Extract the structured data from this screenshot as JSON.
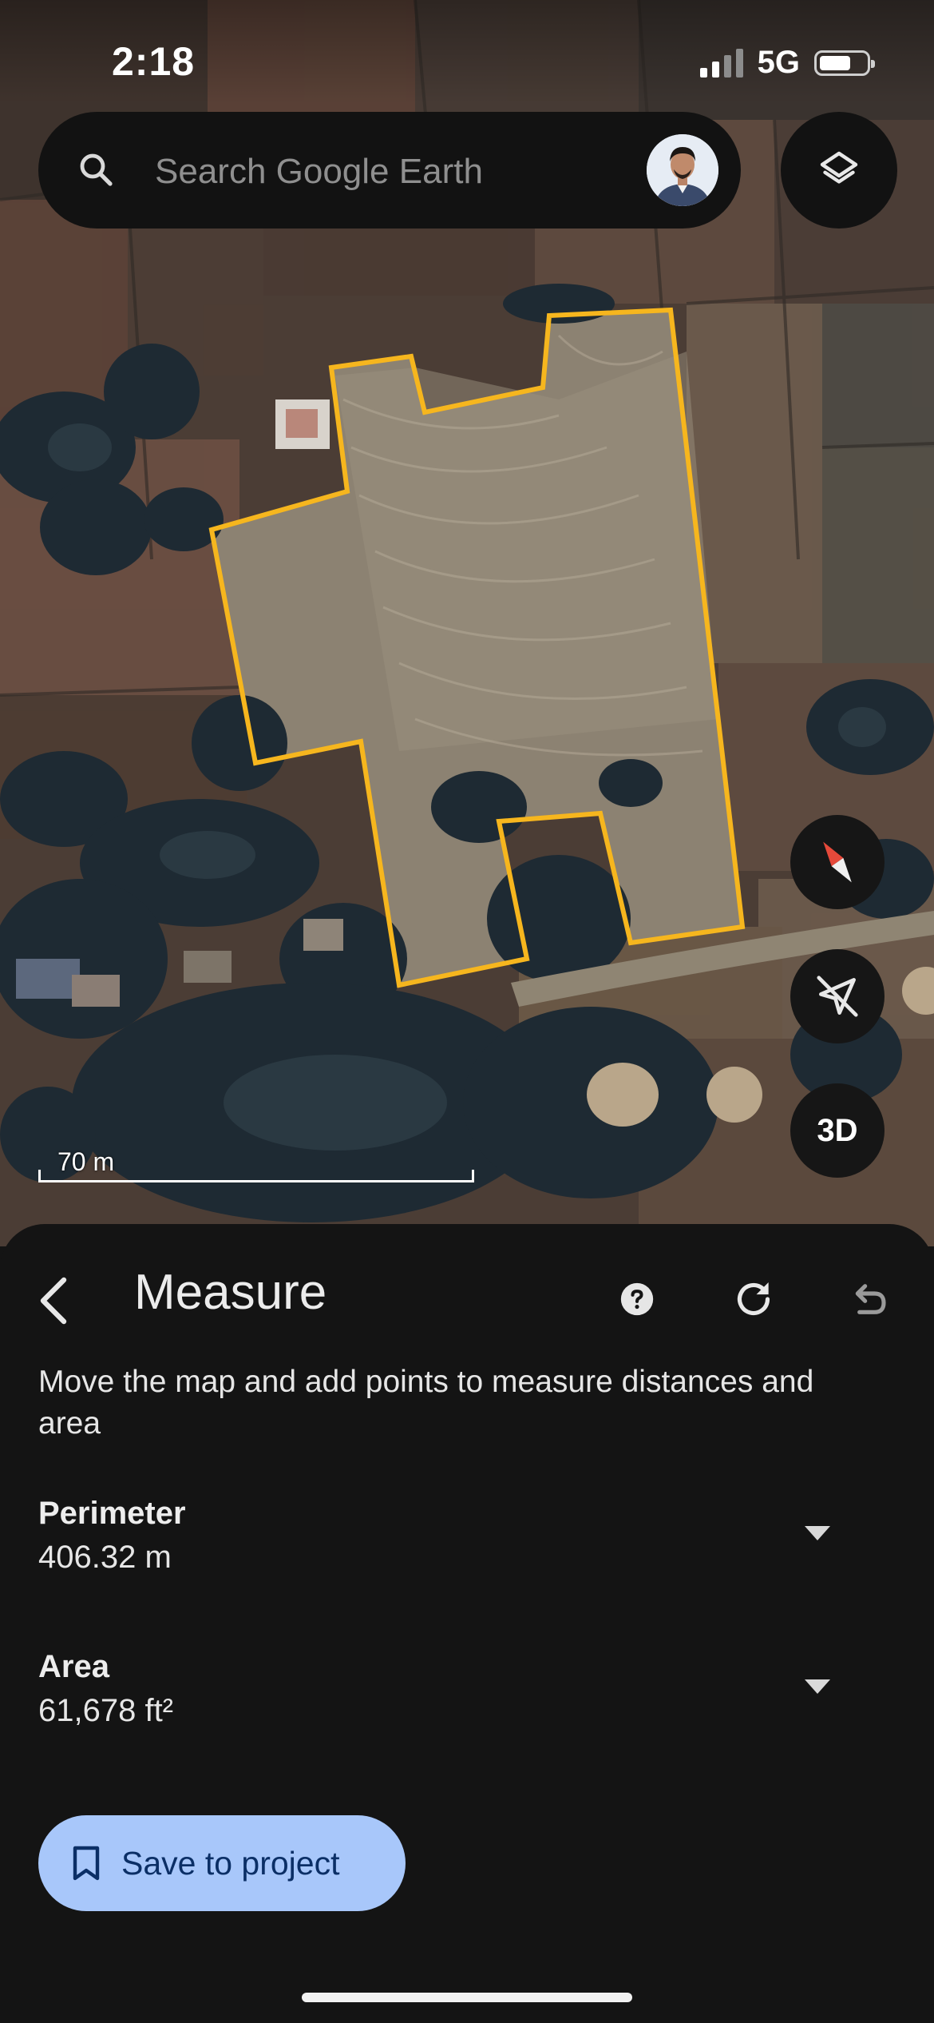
{
  "status_bar": {
    "time": "2:18",
    "network": "5G"
  },
  "search": {
    "placeholder": "Search Google Earth"
  },
  "map": {
    "scale_label": "70 m",
    "three_d_label": "3D"
  },
  "panel": {
    "title": "Measure",
    "description": "Move the map and add points to measure distances and area",
    "metrics": [
      {
        "label": "Perimeter",
        "value": "406.32 m"
      },
      {
        "label": "Area",
        "value": "61,678 ft²"
      }
    ],
    "save_label": "Save to project"
  },
  "colors": {
    "measure_outline": "#f6b61e",
    "save_button_bg": "#a8c7fa",
    "save_button_text": "#0b2f66",
    "panel_bg": "#141414"
  },
  "icons": [
    "search-icon",
    "layers-icon",
    "compass-icon",
    "location-off-icon",
    "back-arrow-icon",
    "help-icon",
    "refresh-icon",
    "undo-icon",
    "bookmark-icon"
  ]
}
